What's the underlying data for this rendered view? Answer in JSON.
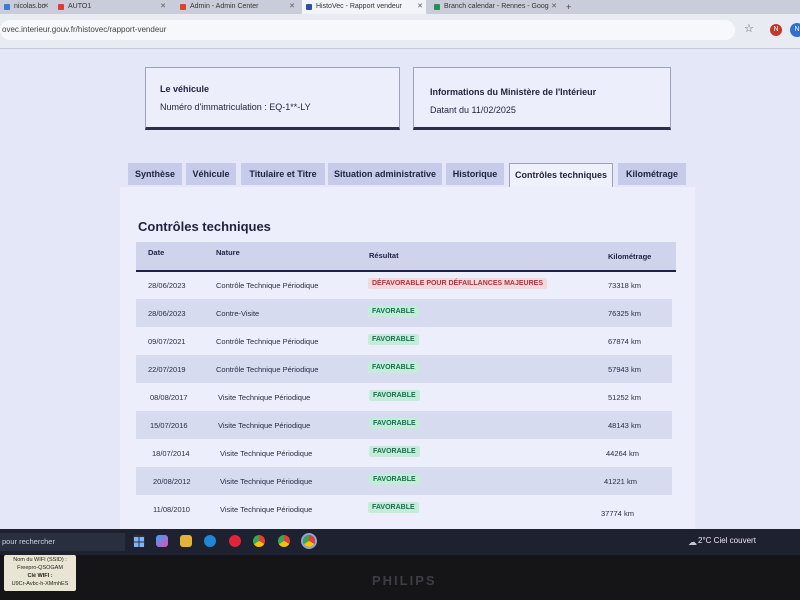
{
  "browser": {
    "tabs": [
      {
        "label": "nicolas.bo",
        "color": "#3b7bd6"
      },
      {
        "label": "AUTO1",
        "color": "#e0393e"
      },
      {
        "label": "Admin - Admin Center",
        "color": "#d9432f"
      },
      {
        "label": "HistoVec - Rapport vendeur",
        "color": "#2b4fa8"
      },
      {
        "label": "Branch calendar - Rennes - Goog",
        "color": "#2a8c5a"
      }
    ],
    "new_tab": "+",
    "url": "ovec.interieur.gouv.fr/histovec/rapport-vendeur",
    "profile_initial": "N",
    "extension_initial": "N"
  },
  "vehicle_box": {
    "title": "Le véhicule",
    "plate_label": "Numéro d'immatriculation : EQ-1**-LY"
  },
  "ministry_box": {
    "title": "Informations du Ministère de l'Intérieur",
    "date_label": "Datant du 11/02/2025"
  },
  "page_tabs": [
    {
      "label": "Synthèse"
    },
    {
      "label": "Véhicule"
    },
    {
      "label": "Titulaire et Titre"
    },
    {
      "label": "Situation administrative"
    },
    {
      "label": "Historique"
    },
    {
      "label": "Contrôles techniques"
    },
    {
      "label": "Kilométrage"
    }
  ],
  "section_title": "Contrôles techniques",
  "table": {
    "headers": {
      "date": "Date",
      "nature": "Nature",
      "result": "Résultat",
      "km": "Kilométrage"
    },
    "rows": [
      {
        "date": "28/06/2023",
        "nature": "Contrôle Technique Périodique",
        "result": "DÉFAVORABLE POUR DÉFAILLANCES MAJEURES",
        "status": "defavorable",
        "km": "73318 km"
      },
      {
        "date": "28/06/2023",
        "nature": "Contre-Visite",
        "result": "FAVORABLE",
        "status": "favorable",
        "km": "76325 km"
      },
      {
        "date": "09/07/2021",
        "nature": "Contrôle Technique Périodique",
        "result": "FAVORABLE",
        "status": "favorable",
        "km": "67874 km"
      },
      {
        "date": "22/07/2019",
        "nature": "Contrôle Technique Périodique",
        "result": "FAVORABLE",
        "status": "favorable",
        "km": "57943 km"
      },
      {
        "date": "08/08/2017",
        "nature": "Visite Technique Périodique",
        "result": "FAVORABLE",
        "status": "favorable",
        "km": "51252 km"
      },
      {
        "date": "15/07/2016",
        "nature": "Visite Technique Périodique",
        "result": "FAVORABLE",
        "status": "favorable",
        "km": "48143 km"
      },
      {
        "date": "18/07/2014",
        "nature": "Visite Technique Périodique",
        "result": "FAVORABLE",
        "status": "favorable",
        "km": "44264 km"
      },
      {
        "date": "20/08/2012",
        "nature": "Visite Technique Périodique",
        "result": "FAVORABLE",
        "status": "favorable",
        "km": "41221 km"
      },
      {
        "date": "11/08/2010",
        "nature": "Visite Technique Périodique",
        "result": "FAVORABLE",
        "status": "favorable",
        "km": "37774 km"
      }
    ]
  },
  "taskbar": {
    "search_placeholder": "pour rechercher",
    "temperature": "2°C",
    "weather": "Ciel couvert",
    "icons": [
      "start-icon",
      "copilot-icon",
      "file-explorer-icon",
      "edge-icon",
      "opera-icon",
      "chrome-icon",
      "chrome-icon",
      "chrome-icon"
    ]
  },
  "monitor": {
    "brand": "PHILIPS",
    "sticker_lines": [
      "Nom du WIFI (SSID) :",
      "Freepro-QSOGAM",
      "Clé WIFI :",
      "U9Cr-Avbc-h-XMmhES"
    ]
  },
  "colors": {
    "favorable_bg": "#c4ecd9",
    "favorable_fg": "#1a6e4e",
    "defavorable_bg": "#f2d9dc",
    "defavorable_fg": "#b0323a",
    "brand_navy": "#1f2140"
  }
}
